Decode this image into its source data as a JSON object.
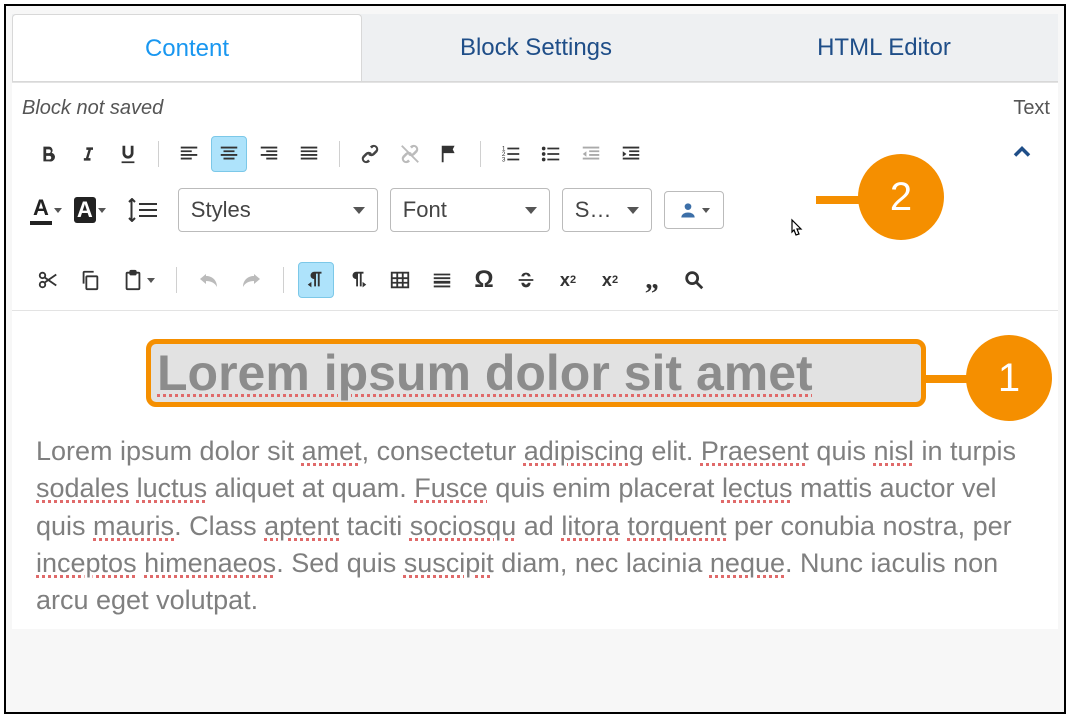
{
  "tabs": {
    "content": "Content",
    "block_settings": "Block Settings",
    "html_editor": "HTML Editor"
  },
  "status": {
    "left": "Block not saved",
    "right": "Text"
  },
  "selects": {
    "styles": "Styles",
    "font": "Font",
    "size": "S…"
  },
  "callouts": {
    "one": "1",
    "two": "2"
  },
  "heading": "Lorem ipsum dolor sit amet",
  "body": {
    "p1a": "Lorem ipsum dolor sit ",
    "w_amet": "amet",
    "p1b": ", consectetur ",
    "w_adipiscing": "adipiscing",
    "p1c": " elit. ",
    "w_praesent": "Praesent",
    "p1d": " quis ",
    "w_nisl": "nisl",
    "p2a": " in turpis ",
    "w_sodales": "sodales",
    "p2b": " ",
    "w_luctus": "luctus",
    "p2c": " aliquet at quam. ",
    "w_fusce": "Fusce",
    "p2d": " quis enim placerat ",
    "w_lectus": "lectus",
    "p3a": " mattis auctor vel quis ",
    "w_mauris": "mauris",
    "p3b": ". Class ",
    "w_aptent": "aptent",
    "p3c": " taciti ",
    "w_sociosqu": "sociosqu",
    "p3d": " ad ",
    "w_litora": "litora",
    "p4a": " ",
    "w_torquent": "torquent",
    "p4b": " per conubia nostra, per ",
    "w_inceptos": "inceptos",
    "p4c": " ",
    "w_himenaeos": "himenaeos",
    "p4d": ". Sed quis ",
    "w_suscipit": "suscipit",
    "p5a": " diam, nec lacinia ",
    "w_neque": "neque",
    "p5b": ". Nunc iaculis non arcu eget volutpat."
  }
}
